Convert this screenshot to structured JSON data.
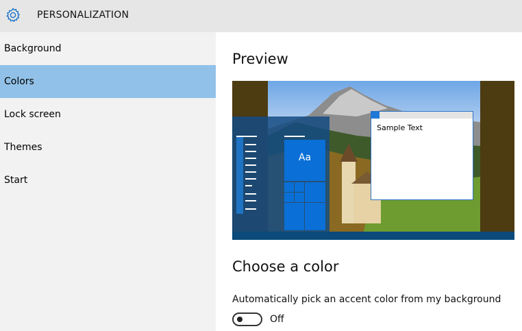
{
  "header": {
    "title": "PERSONALIZATION",
    "icon": "gear-icon"
  },
  "sidebar": {
    "items": [
      {
        "label": "Background",
        "active": false
      },
      {
        "label": "Colors",
        "active": true
      },
      {
        "label": "Lock screen",
        "active": false
      },
      {
        "label": "Themes",
        "active": false
      },
      {
        "label": "Start",
        "active": false
      }
    ]
  },
  "main": {
    "preview_heading": "Preview",
    "preview": {
      "tile_label": "Aa",
      "window_text": "Sample Text"
    },
    "color_heading": "Choose a color",
    "auto_color": {
      "label": "Automatically pick an accent color from my background",
      "state_label": "Off",
      "on": false
    }
  },
  "colors": {
    "accent": "#1E79D8",
    "selected_nav": "#91C1E8",
    "header_bg": "#E6E6E6",
    "sidebar_bg": "#F2F2F2"
  }
}
